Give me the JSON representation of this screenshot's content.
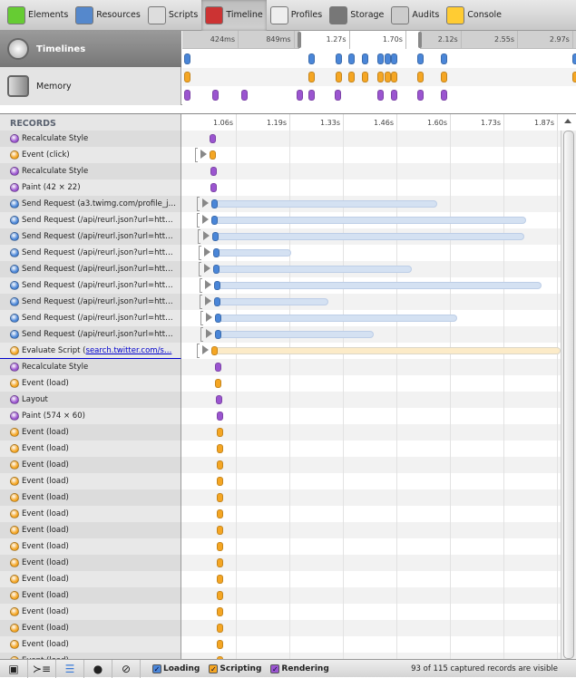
{
  "colors": {
    "loading": "#4a86d8",
    "scripting": "#f5a623",
    "rendering": "#9b55d0",
    "loading_bar": "#d4e1f2",
    "scripting_bar": "#fcebc8"
  },
  "toolbar": [
    {
      "label": "Elements",
      "icon": "elements-icon",
      "color": "#6c3"
    },
    {
      "label": "Resources",
      "icon": "resources-icon",
      "color": "#58c"
    },
    {
      "label": "Scripts",
      "icon": "scripts-icon",
      "color": "#ddd"
    },
    {
      "label": "Timeline",
      "icon": "timeline-icon",
      "color": "#c33",
      "selected": true
    },
    {
      "label": "Profiles",
      "icon": "profiles-icon",
      "color": "#eee"
    },
    {
      "label": "Storage",
      "icon": "storage-icon",
      "color": "#777"
    },
    {
      "label": "Audits",
      "icon": "audits-icon",
      "color": "#ccc"
    },
    {
      "label": "Console",
      "icon": "console-icon",
      "color": "#fc3"
    }
  ],
  "overview": {
    "items": [
      "Timelines",
      "Memory"
    ],
    "ticks": [
      "424ms",
      "849ms",
      "1.27s",
      "1.70s",
      "2.12s",
      "2.55s",
      "2.97s"
    ],
    "tick_values": [
      0.424,
      0.849,
      1.27,
      1.7,
      2.12,
      2.55,
      2.97
    ],
    "selection": [
      0.89,
      1.81
    ],
    "loading": [
      0.04,
      0.98,
      1.19,
      1.29,
      1.39,
      1.51,
      1.56,
      1.61,
      1.81,
      1.99,
      2.99
    ],
    "scripting": [
      0.04,
      0.98,
      1.19,
      1.29,
      1.39,
      1.51,
      1.56,
      1.61,
      1.81,
      1.99,
      2.99
    ],
    "rendering": [
      0.04,
      0.25,
      0.47,
      0.89,
      0.98,
      1.18,
      1.51,
      1.61,
      1.81,
      1.99
    ]
  },
  "records": {
    "header": "RECORDS",
    "ticks": [
      "1.06s",
      "1.19s",
      "1.33s",
      "1.46s",
      "1.60s",
      "1.73s",
      "1.87s"
    ],
    "tick_values": [
      1.06,
      1.195,
      1.33,
      1.465,
      1.6,
      1.735,
      1.87
    ],
    "rows": [
      {
        "label": "Recalculate Style",
        "type": "rendering",
        "start": 1.0
      },
      {
        "label": "Event (click)",
        "type": "scripting",
        "start": 1.0,
        "expandable": true
      },
      {
        "label": "Recalculate Style",
        "type": "rendering",
        "start": 1.002
      },
      {
        "label": "Paint (42 × 22)",
        "type": "rendering",
        "start": 1.002
      },
      {
        "label": "Send Request (a3.twimg.com/profile_j…",
        "type": "loading",
        "start": 1.005,
        "end": 1.568,
        "expandable": true
      },
      {
        "label": "Send Request (/api/reurl.json?url=htt…",
        "type": "loading",
        "start": 1.005,
        "end": 1.792,
        "expandable": true
      },
      {
        "label": "Send Request (/api/reurl.json?url=htt…",
        "type": "loading",
        "start": 1.007,
        "end": 1.788,
        "expandable": true
      },
      {
        "label": "Send Request (/api/reurl.json?url=htt…",
        "type": "loading",
        "start": 1.01,
        "end": 1.2,
        "expandable": true
      },
      {
        "label": "Send Request (/api/reurl.json?url=htt…",
        "type": "loading",
        "start": 1.01,
        "end": 1.504,
        "expandable": true
      },
      {
        "label": "Send Request (/api/reurl.json?url=htt…",
        "type": "loading",
        "start": 1.012,
        "end": 1.831,
        "expandable": true
      },
      {
        "label": "Send Request (/api/reurl.json?url=htt…",
        "type": "loading",
        "start": 1.012,
        "end": 1.293,
        "expandable": true
      },
      {
        "label": "Send Request (/api/reurl.json?url=htt…",
        "type": "loading",
        "start": 1.014,
        "end": 1.618,
        "expandable": true
      },
      {
        "label": "Send Request (/api/reurl.json?url=htt…",
        "type": "loading",
        "start": 1.014,
        "end": 1.408,
        "expandable": true
      },
      {
        "label": "Evaluate Script (",
        "link": "search.twitter.com/s…",
        "type": "scripting",
        "start": 1.005,
        "end": 1.95,
        "expandable": true
      },
      {
        "label": "Recalculate Style",
        "type": "rendering",
        "start": 1.014
      },
      {
        "label": "Event (load)",
        "type": "scripting",
        "start": 1.014
      },
      {
        "label": "Layout",
        "type": "rendering",
        "start": 1.017
      },
      {
        "label": "Paint (574 × 60)",
        "type": "rendering",
        "start": 1.019
      },
      {
        "label": "Event (load)",
        "type": "scripting",
        "start": 1.019
      },
      {
        "label": "Event (load)",
        "type": "scripting",
        "start": 1.019
      },
      {
        "label": "Event (load)",
        "type": "scripting",
        "start": 1.019
      },
      {
        "label": "Event (load)",
        "type": "scripting",
        "start": 1.019
      },
      {
        "label": "Event (load)",
        "type": "scripting",
        "start": 1.019
      },
      {
        "label": "Event (load)",
        "type": "scripting",
        "start": 1.019
      },
      {
        "label": "Event (load)",
        "type": "scripting",
        "start": 1.019
      },
      {
        "label": "Event (load)",
        "type": "scripting",
        "start": 1.019
      },
      {
        "label": "Event (load)",
        "type": "scripting",
        "start": 1.019
      },
      {
        "label": "Event (load)",
        "type": "scripting",
        "start": 1.019
      },
      {
        "label": "Event (load)",
        "type": "scripting",
        "start": 1.019
      },
      {
        "label": "Event (load)",
        "type": "scripting",
        "start": 1.019
      },
      {
        "label": "Event (load)",
        "type": "scripting",
        "start": 1.019
      },
      {
        "label": "Event (load)",
        "type": "scripting",
        "start": 1.019
      },
      {
        "label": "Event (load)",
        "type": "scripting",
        "start": 1.019
      }
    ]
  },
  "bottom": {
    "buttons": [
      {
        "icon": "dock-icon",
        "glyph": "▣"
      },
      {
        "icon": "console-prompt-icon",
        "glyph": "≻≡"
      },
      {
        "icon": "list-view-icon",
        "glyph": "☰"
      },
      {
        "icon": "record-icon",
        "glyph": "●"
      },
      {
        "icon": "clear-icon",
        "glyph": "⊘"
      }
    ],
    "filters": [
      {
        "label": "Loading",
        "type": "loading",
        "checked": true
      },
      {
        "label": "Scripting",
        "type": "scripting",
        "checked": true
      },
      {
        "label": "Rendering",
        "type": "rendering",
        "checked": true
      }
    ],
    "status": "93 of 115 captured records are visible"
  }
}
